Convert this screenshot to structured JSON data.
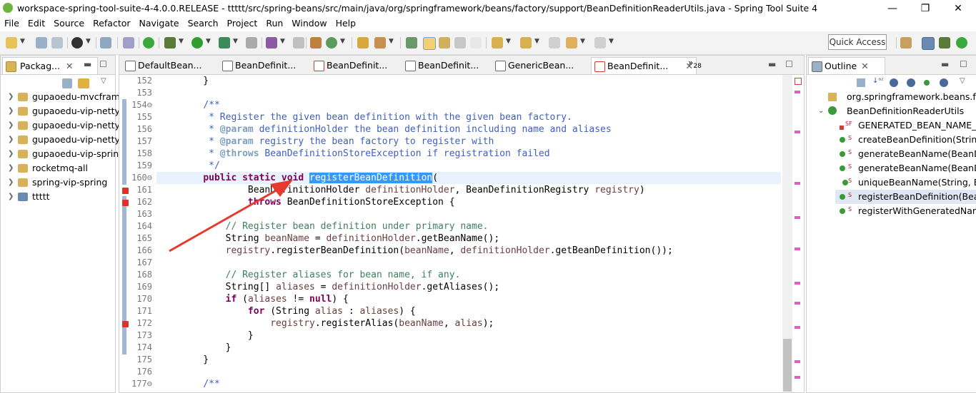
{
  "window": {
    "title": "workspace-spring-tool-suite-4-4.0.0.RELEASE - ttttt/src/spring-beans/src/main/java/org/springframework/beans/factory/support/BeanDefinitionReaderUtils.java - Spring Tool Suite 4",
    "minimize": "—",
    "restore": "❐",
    "close": "✕"
  },
  "menu": [
    "File",
    "Edit",
    "Source",
    "Refactor",
    "Navigate",
    "Search",
    "Project",
    "Run",
    "Window",
    "Help"
  ],
  "toolbar": {
    "quick_access": "Quick Access"
  },
  "package_explorer": {
    "tab_label": "Packag...",
    "items": [
      "gupaoedu-mvcfram",
      "gupaoedu-vip-netty",
      "gupaoedu-vip-netty",
      "gupaoedu-vip-netty",
      "gupaoedu-vip-sprin",
      "rocketmq-all",
      "spring-vip-spring",
      "ttttt"
    ]
  },
  "editor": {
    "tabs": [
      "DefaultBean...",
      "BeanDefinit...",
      "BeanDefinit...",
      "BeanDefinit...",
      "GenericBean...",
      "BeanDefinit..."
    ],
    "overflow": "»",
    "overflow_count": "28",
    "line_numbers": [
      "152",
      "153",
      "154⊖",
      "155",
      "156",
      "157",
      "158",
      "159",
      "160⊖",
      "161",
      "162",
      "163",
      "164",
      "165",
      "166",
      "167",
      "168",
      "169",
      "170",
      "171",
      "172",
      "173",
      "174",
      "175",
      "176",
      "177⊖"
    ]
  },
  "outline": {
    "tab_label": "Outline",
    "package": "org.springframework.beans.fa",
    "class": "BeanDefinitionReaderUtils",
    "members": [
      "GENERATED_BEAN_NAME_S",
      "createBeanDefinition(String,",
      "generateBeanName(BeanDe",
      "generateBeanName(BeanDe",
      "uniqueBeanName(String, Be",
      "registerBeanDefinition(Bean",
      "registerWithGeneratedNam"
    ]
  },
  "colors": {
    "keyword": "#7f0055",
    "javadoc": "#3f5fbf",
    "comment": "#3f7f5f",
    "selection": "#3399ff",
    "arrow": "#e8392f"
  }
}
